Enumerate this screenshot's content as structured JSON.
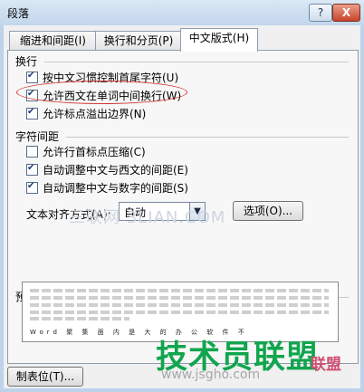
{
  "window": {
    "title": "段落",
    "help_label": "?",
    "close_label": "X"
  },
  "tabs": [
    {
      "label": "缩进和间距(I)"
    },
    {
      "label": "换行和分页(P)"
    },
    {
      "label": "中文版式(H)"
    }
  ],
  "line_break": {
    "title": "换行",
    "options": [
      {
        "label": "按中文习惯控制首尾字符(U)",
        "checked": true
      },
      {
        "label": "允许西文在单词中间换行(W)",
        "checked": true
      },
      {
        "label": "允许标点溢出边界(N)",
        "checked": true
      }
    ]
  },
  "char_spacing": {
    "title": "字符间距",
    "options": [
      {
        "label": "允许行首标点压缩(C)",
        "checked": false
      },
      {
        "label": "自动调整中文与西文的间距(E)",
        "checked": true
      },
      {
        "label": "自动调整中文与数字的间距(S)",
        "checked": true
      }
    ]
  },
  "alignment": {
    "label": "文本对齐方式(A):",
    "value": "自动",
    "options_button": "选项(O)..."
  },
  "preview": {
    "title": "预览",
    "sample_text": "Word 聚 集 面 内 是 大 的 办 公 软 件 不"
  },
  "footer": {
    "tabs_button": "制表位(T)..."
  },
  "watermarks": {
    "site1": "三联网 3LIAN.COM",
    "site2": "技术员联盟",
    "site3": "www.jsgho.com",
    "site4": "联盟"
  },
  "colors": {
    "annotation": "#d03434",
    "accent": "#11a54e"
  }
}
